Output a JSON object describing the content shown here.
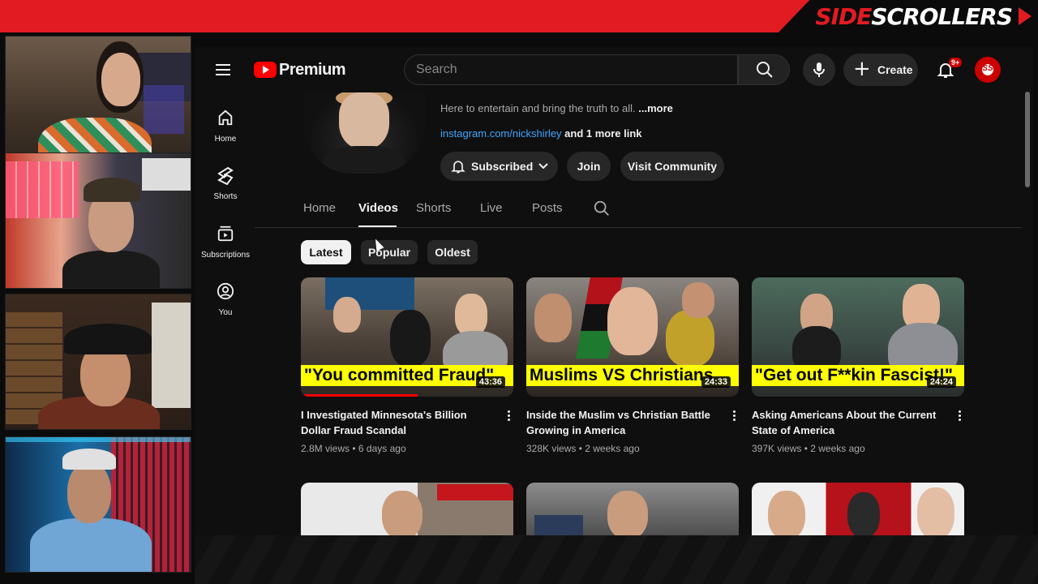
{
  "overlay": {
    "brand_side": "SIDE",
    "brand_scrollers": "SCROLLERS"
  },
  "header": {
    "logo_text": "Premium",
    "search_placeholder": "Search",
    "create_label": "Create",
    "notification_count": "9+",
    "avatar_text": "SS"
  },
  "sidebar": {
    "items": [
      {
        "label": "Home",
        "icon": "home-icon"
      },
      {
        "label": "Shorts",
        "icon": "shorts-icon"
      },
      {
        "label": "Subscriptions",
        "icon": "subscriptions-icon"
      },
      {
        "label": "You",
        "icon": "you-icon"
      }
    ]
  },
  "channel": {
    "description": "Here to entertain and bring the truth to all.",
    "more": "...more",
    "link": "instagram.com/nickshirley",
    "more_links": "and 1 more link",
    "subscribed_label": "Subscribed",
    "join_label": "Join",
    "community_label": "Visit Community"
  },
  "tabs": [
    {
      "label": "Home",
      "active": false
    },
    {
      "label": "Videos",
      "active": true
    },
    {
      "label": "Shorts",
      "active": false
    },
    {
      "label": "Live",
      "active": false
    },
    {
      "label": "Posts",
      "active": false
    }
  ],
  "filters": [
    {
      "label": "Latest",
      "active": true
    },
    {
      "label": "Popular",
      "active": false
    },
    {
      "label": "Oldest",
      "active": false
    }
  ],
  "videos": [
    {
      "title": "I Investigated Minnesota's Billion Dollar Fraud Scandal",
      "views": "2.8M views",
      "age": "6 days ago",
      "duration": "43:36",
      "thumb_caption": "\"You committed Fraud\"",
      "watched_fraction": 0.55
    },
    {
      "title": "Inside the Muslim vs Christian Battle Growing in America",
      "views": "328K views",
      "age": "2 weeks ago",
      "duration": "24:33",
      "thumb_caption": "Muslims VS Christians",
      "watched_fraction": 0
    },
    {
      "title": "Asking Americans About the Current State of America",
      "views": "397K views",
      "age": "2 weeks ago",
      "duration": "24:24",
      "thumb_caption": "\"Get out F**kin Fascist!\"",
      "watched_fraction": 0
    }
  ],
  "colors": {
    "brand_red": "#e21b23",
    "yt_red": "#ff0000",
    "link_blue": "#3ea6ff",
    "caption_yellow": "#ffff00"
  }
}
